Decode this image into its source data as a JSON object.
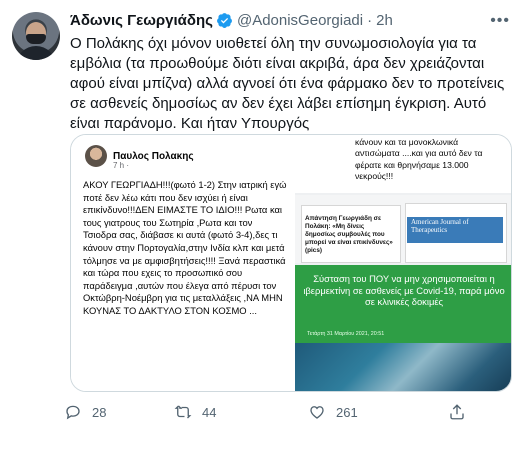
{
  "tweet": {
    "author_name": "Άδωνις Γεωργιάδης",
    "handle": "@AdonisGeorgiadi",
    "time": "2h",
    "text": "Ο Πολάκης όχι μόνον υιοθετεί όλη την συνωμοσιολογία για τα εμβόλια (τα προωθούμε διότι είναι ακριβά, άρα δεν χρειάζονται αφού είναι μπίζνα) αλλά αγνοεί ότι ένα φάρμακο δεν το προτείνεις σε ασθενείς δημοσίως αν δεν έχει λάβει επίσημη έγκριση. Αυτό είναι παράνομο. Και ήταν Υπουργός",
    "icons": {
      "verified": "verified-badge-icon",
      "more": "more-icon"
    },
    "accent_color": "#1d9bf0"
  },
  "media": {
    "fb_post": {
      "author": "Παυλος Πολακης",
      "time": "7 h ·",
      "body": "ΑΚΟΥ ΓΕΩΡΓΙΑΔΗ!!!(φωτό 1-2) Στην ιατρική εγώ ποτέ δεν λέω κάτι που δεν ισχύει ή είναι επικίνδυνο!!!ΔΕΝ ΕΙΜΑΣΤΕ ΤΟ ΙΔΙΟ!!! Ρωτα και τους γιατρους του Σωτηρία ,Ρωτα και τον Τσιοδρα σας, διάβασε κι αυτά (φωτό 3-4),δες τι κάνουν στην Πορτογαλία,στην Ινδία κλπ και μετά τόλμησε να με αμφισβητήσεις!!!! Ξανά περαστικά και τώρα που εχεις το προσωπικό σου παράδειγμα ,αυτών που έλεγα από πέρυσι τον Οκτώβρη-Νοέμβρη για τις μεταλλάξεις ,ΝΑ ΜΗΝ ΚΟΥΝΑΣ ΤΟ ΔΑΚΤΥΛΟ ΣΤΟΝ ΚΟΣΜΟ ... "
    },
    "right_top_text": "κάνουν και τα μονοκλωνικά αντισώματα ....και για αυτό δεν τα φέρατε και θρηνήσαμε 13.000 νεκρούς!!!",
    "card_text": "Απάντηση Γεωργιάδη σε Πολάκη: «Μη δίνεις δημοσίως συμβουλές που μπορεί να είναι επικίνδυνες» (pics)",
    "journal_title": "American Journal of Therapeutics",
    "green_caption": "Σύσταση του ΠΟΥ να μην χρησιμοποιείται η ιβερμεκτίνη σε ασθενείς με Covid-19, παρά μόνο σε κλινικές δοκιμές",
    "green_date": "Τετάρτη 31 Μαρτίου 2021, 20:51",
    "green_color": "#2e9e45"
  },
  "actions": {
    "reply_count": "28",
    "retweet_count": "44",
    "like_count": "261",
    "icons": [
      "reply-icon",
      "retweet-icon",
      "like-icon",
      "share-icon"
    ]
  }
}
